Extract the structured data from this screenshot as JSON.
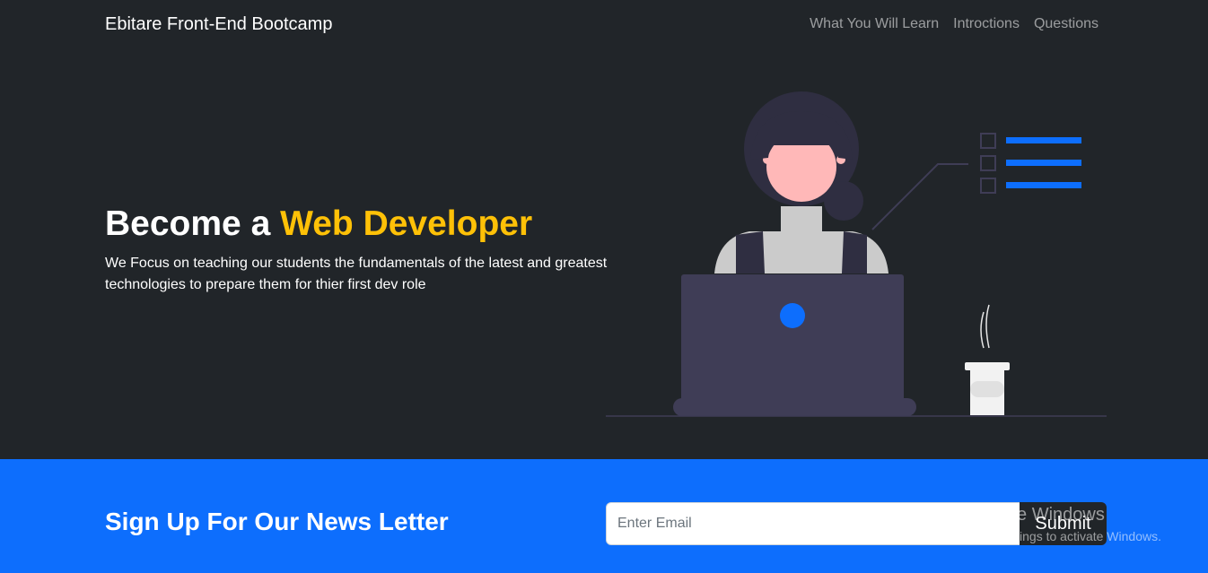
{
  "navbar": {
    "brand": "Ebitare Front-End Bootcamp",
    "links": [
      "What You Will Learn",
      "Introctions",
      "Questions"
    ]
  },
  "hero": {
    "title_prefix": "Become a ",
    "title_accent": "Web Developer",
    "text": "We Focus on teaching our students the fundamentals of the latest and greatest technologies to prepare them for thier first dev role",
    "accent_color": "#ffc107"
  },
  "illustration": {
    "icon": "developer-at-laptop-illustration"
  },
  "newsletter": {
    "title": "Sign Up For Our News Letter",
    "email_placeholder": "Enter Email",
    "email_value": "",
    "submit_label": "Submit",
    "background_color": "#0d6efd"
  },
  "watermark": {
    "title": "Activate Windows",
    "subtitle": "Go to Settings to activate Windows."
  }
}
